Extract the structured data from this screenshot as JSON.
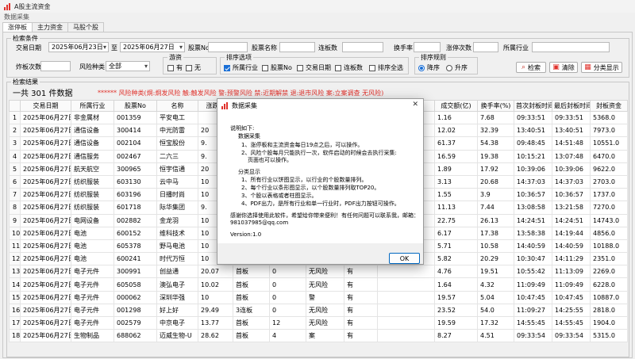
{
  "window": {
    "title": "A股主流资金"
  },
  "menu": {
    "label": "数据采集"
  },
  "tabs": [
    {
      "label": "涨停板"
    },
    {
      "label": "主力资金"
    },
    {
      "label": "马股个股"
    }
  ],
  "search": {
    "group_label": "检索条件",
    "trade_date_label": "交易日期",
    "date_from": "2025年06月23日",
    "to_label": "至",
    "date_to": "2025年06月27日",
    "code_label": "股票No",
    "code_value": "",
    "name_label": "股票名称",
    "name_value": "",
    "board_label": "连板数",
    "board_value": "",
    "turnover_label": "换手率",
    "turnover_value": "",
    "limitup_count_label": "涨停次数",
    "limitup_count_value": "",
    "industry_label": "所属行业",
    "industry_value": "",
    "blast_count_label": "炸板次数",
    "blast_count_value": "",
    "risk_type_label": "风险种类",
    "risk_type_value": "全部",
    "game_label": "游资",
    "game_yes": "有",
    "game_no": "无",
    "sort_options_label": "排序选项",
    "sort_industry": "所属行业",
    "sort_code": "股票No",
    "sort_date": "交易日期",
    "sort_board": "连板数",
    "sort_all": "排序全选",
    "sort_rule_label": "排序规则",
    "sort_desc": "降序",
    "sort_asc": "升序",
    "search_button": "检索",
    "clear_button": "清除",
    "classify_button": "分类显示"
  },
  "results": {
    "group_label": "检索结果",
    "count_text": "一共 301 件数据",
    "risk_legend": "****** 风险种类(炯:炯发风险 触:触发风险 警:预警风险 禁:近期解禁 退:退市风险 案:立案调查  无风险)",
    "columns": [
      "",
      "交易日期",
      "所属行业",
      "股票No",
      "名称",
      "涨跌幅",
      "",
      "",
      "",
      "",
      "",
      "成交额(亿)",
      "换手率(%)",
      "首次封板时间",
      "最后封板时间",
      "封板资金"
    ],
    "rows": [
      [
        "1",
        "2025年06月27日",
        "非金属材",
        "001359",
        "平安电工",
        "",
        "",
        "",
        "",
        "",
        "",
        "1.16",
        "7.68",
        "09:33:51",
        "09:33:51",
        "5368.0"
      ],
      [
        "2",
        "2025年06月27日",
        "通信设备",
        "300414",
        "中光防雷",
        "20",
        "",
        "",
        "",
        "",
        "",
        "12.02",
        "32.39",
        "13:40:51",
        "13:40:51",
        "7973.0"
      ],
      [
        "3",
        "2025年06月27日",
        "通信设备",
        "002104",
        "恒宝股份",
        "9.",
        "",
        "",
        "",
        "",
        "",
        "61.37",
        "54.38",
        "09:48:45",
        "14:51:48",
        "10551.0"
      ],
      [
        "4",
        "2025年06月27日",
        "通信服务",
        "002467",
        "二六三",
        "9.",
        "",
        "",
        "",
        "",
        "",
        "16.59",
        "19.38",
        "10:15:21",
        "13:07:48",
        "6470.0"
      ],
      [
        "5",
        "2025年06月27日",
        "航天航空",
        "300965",
        "恒宇信通",
        "20",
        "",
        "",
        "",
        "",
        "",
        "1.89",
        "17.92",
        "10:39:06",
        "10:39:06",
        "9622.0"
      ],
      [
        "6",
        "2025年06月27日",
        "纺织服装",
        "603130",
        "云中马",
        "10",
        "",
        "",
        "",
        "",
        "",
        "3.13",
        "20.68",
        "14:37:03",
        "14:37:03",
        "2703.0"
      ],
      [
        "7",
        "2025年06月27日",
        "纺织服装",
        "603196",
        "日播时尚",
        "10",
        "",
        "",
        "",
        "",
        "",
        "1.55",
        "3.9",
        "10:36:57",
        "10:36:57",
        "1737.0"
      ],
      [
        "8",
        "2025年06月27日",
        "纺织服装",
        "601718",
        "际华集团",
        "9.",
        "",
        "",
        "",
        "",
        "",
        "11.13",
        "7.44",
        "13:08:58",
        "13:21:58",
        "7270.0"
      ],
      [
        "9",
        "2025年06月27日",
        "电网设备",
        "002882",
        "金龙羽",
        "10",
        "",
        "",
        "",
        "",
        "",
        "22.75",
        "26.13",
        "14:24:51",
        "14:24:51",
        "14743.0"
      ],
      [
        "10",
        "2025年06月27日",
        "电池",
        "600152",
        "维科技术",
        "10",
        "",
        "",
        "",
        "",
        "",
        "6.17",
        "17.38",
        "13:58:38",
        "14:19:44",
        "4856.0"
      ],
      [
        "11",
        "2025年06月27日",
        "电池",
        "605378",
        "野马电池",
        "10",
        "",
        "",
        "",
        "",
        "",
        "5.71",
        "10.58",
        "14:40:59",
        "14:40:59",
        "10188.0"
      ],
      [
        "12",
        "2025年06月27日",
        "电池",
        "600241",
        "时代万恒",
        "10",
        "",
        "",
        "",
        "",
        "",
        "5.82",
        "20.29",
        "10:30:47",
        "14:11:29",
        "2351.0"
      ],
      [
        "13",
        "2025年06月27日",
        "电子元件",
        "300991",
        "创益通",
        "20.07",
        "首板",
        "0",
        "无风险",
        "有",
        "",
        "4.76",
        "19.51",
        "10:55:42",
        "11:13:09",
        "2269.0"
      ],
      [
        "14",
        "2025年06月27日",
        "电子元件",
        "605058",
        "澳弘电子",
        "10.02",
        "首板",
        "0",
        "无风险",
        "有",
        "",
        "1.64",
        "4.32",
        "11:09:49",
        "11:09:49",
        "6228.0"
      ],
      [
        "15",
        "2025年06月27日",
        "电子元件",
        "000062",
        "深圳华强",
        "10",
        "首板",
        "0",
        "警",
        "有",
        "",
        "19.57",
        "5.04",
        "10:47:45",
        "10:47:45",
        "10887.0"
      ],
      [
        "16",
        "2025年06月27日",
        "电子元件",
        "001298",
        "好上好",
        "29.49",
        "3连板",
        "0",
        "无风险",
        "有",
        "",
        "23.52",
        "54.0",
        "11:09:27",
        "14:25:55",
        "2818.0"
      ],
      [
        "17",
        "2025年06月27日",
        "电子元件",
        "002579",
        "中京电子",
        "13.77",
        "首板",
        "12",
        "无风险",
        "有",
        "",
        "19.59",
        "17.32",
        "14:55:45",
        "14:55:45",
        "1904.0"
      ],
      [
        "18",
        "2025年06月27日",
        "生物制品",
        "688062",
        "迈威生物-U",
        "28.62",
        "首板",
        "4",
        "案",
        "有",
        "",
        "8.27",
        "4.51",
        "09:33:54",
        "09:33:54",
        "5315.0"
      ]
    ]
  },
  "dialog": {
    "title": "数据采集",
    "close": "✕",
    "lines": [
      "说明如下:",
      "数据采集",
      "1、涨停板和主流资金每日19点之后，可以操作。",
      "2、风险个股每月只能执行一次，软件启动的时候会去执行采集:",
      "页面也可以操作。",
      "分类显示",
      "1、所有行业以饼图显示，以行业的个股数量排列。",
      "2、每个行业以条形图显示，以个股数量排列取TOP20。",
      "3、个股以表格或者柱图显示。",
      "4、PDF出力，是所有行业和单一行业时，PDF出力按钮可操作。",
      "感谢你选择使用此软件，希望给你带来便利！有任何问题可以联系我，邮箱：",
      "981037985@qq.com",
      "Version:1.0"
    ],
    "ok_button": "OK"
  },
  "colors": {
    "accent": "#1a6fd6",
    "risk_red": "#e0312b"
  },
  "icons": [
    "chart-bar-icon",
    "search-icon",
    "clear-icon",
    "classify-icon",
    "close-icon"
  ]
}
